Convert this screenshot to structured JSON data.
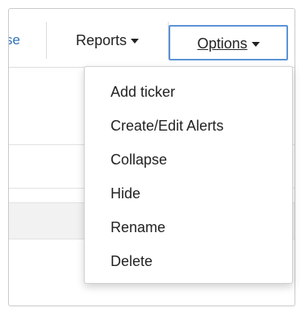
{
  "tabs": {
    "partial_label": "se",
    "reports_label": "Reports",
    "options_label": "Options"
  },
  "options_menu": {
    "items": [
      {
        "label": "Add ticker"
      },
      {
        "label": "Create/Edit Alerts"
      },
      {
        "label": "Collapse"
      },
      {
        "label": "Hide"
      },
      {
        "label": "Rename"
      },
      {
        "label": "Delete"
      }
    ]
  },
  "colors": {
    "link_blue": "#2d6fb7",
    "active_border": "#5b93d6",
    "text": "#222222"
  },
  "icons": {
    "dropdown": "caret-down-icon"
  }
}
